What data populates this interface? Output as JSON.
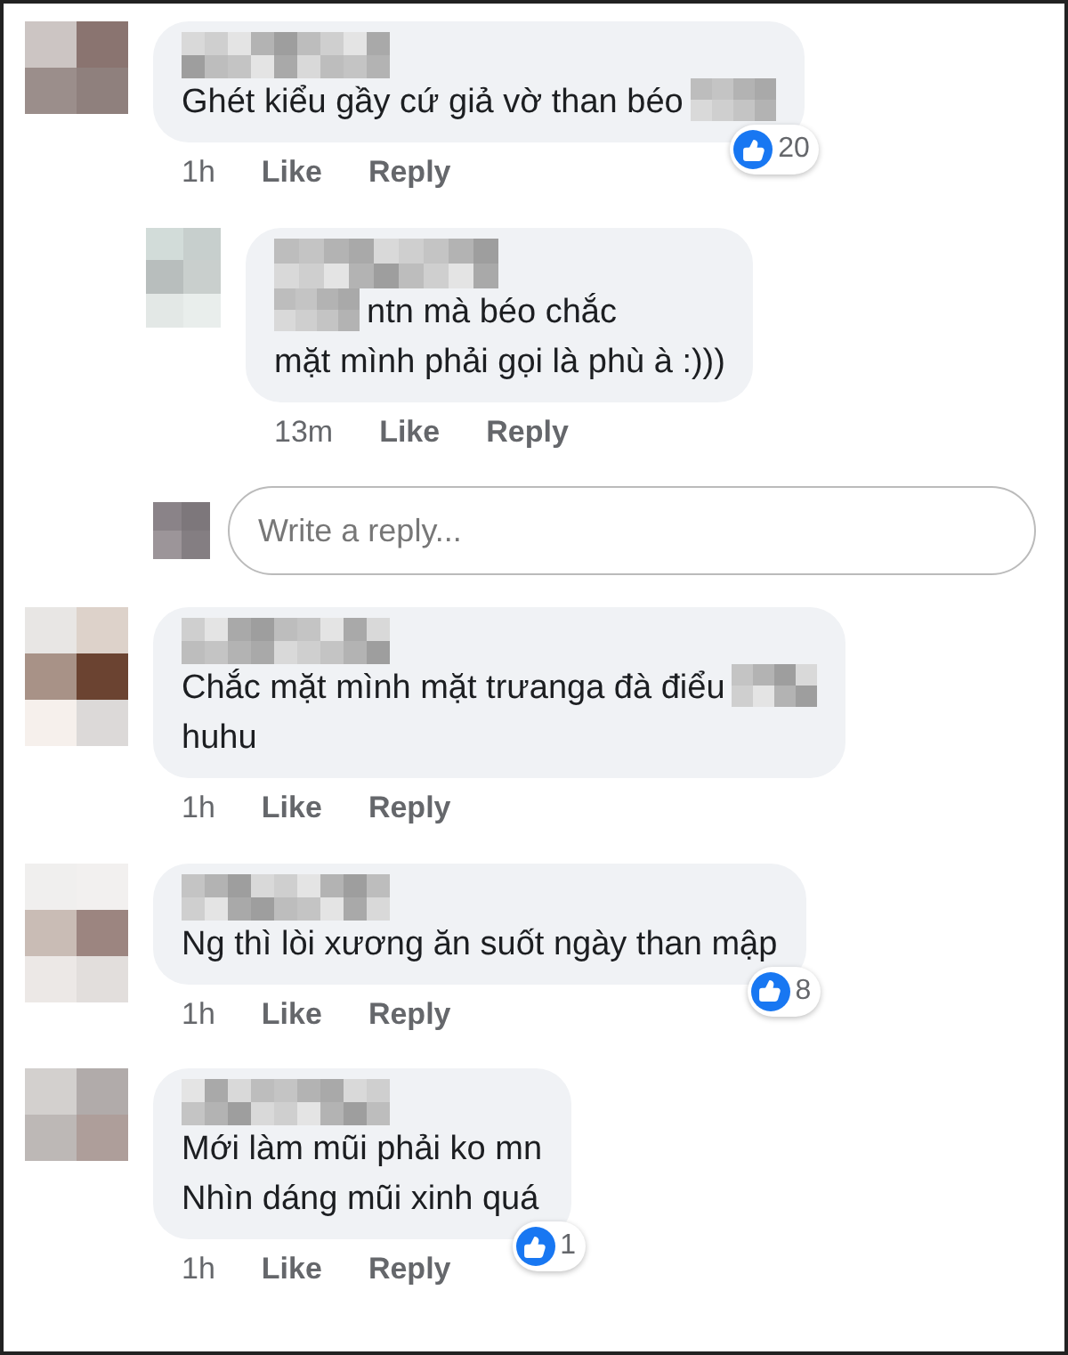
{
  "comments": [
    {
      "lines": [
        [
          {
            "kind": "text",
            "text": "Ghét kiểu gầy cứ giả vờ than béo"
          },
          {
            "kind": "redacted"
          }
        ]
      ],
      "time": "1h",
      "like": "Like",
      "reply": "Reply",
      "reactions": "20",
      "replies": [
        {
          "lines": [
            [
              {
                "kind": "redacted"
              },
              {
                "kind": "text",
                "text": "ntn mà béo chắc"
              }
            ],
            [
              {
                "kind": "text",
                "text": "mặt mình phải gọi là phù à :)))"
              }
            ]
          ],
          "time": "13m",
          "like": "Like",
          "reply": "Reply"
        }
      ],
      "reply_field": {
        "placeholder": "Write a reply..."
      }
    },
    {
      "lines": [
        [
          {
            "kind": "text",
            "text": "Chắc mặt mình mặt trưanga đà điểu"
          },
          {
            "kind": "redacted"
          }
        ],
        [
          {
            "kind": "text",
            "text": "huhu"
          }
        ]
      ],
      "time": "1h",
      "like": "Like",
      "reply": "Reply"
    },
    {
      "lines": [
        [
          {
            "kind": "text",
            "text": "Ng thì lòi xương ăn suốt ngày than mập"
          }
        ]
      ],
      "time": "1h",
      "like": "Like",
      "reply": "Reply",
      "reactions": "8"
    },
    {
      "lines": [
        [
          {
            "kind": "text",
            "text": "Mới làm mũi phải ko mn"
          }
        ],
        [
          {
            "kind": "text",
            "text": "Nhìn dáng mũi xinh quá"
          }
        ]
      ],
      "time": "1h",
      "like": "Like",
      "reply": "Reply",
      "reactions": "1"
    }
  ]
}
